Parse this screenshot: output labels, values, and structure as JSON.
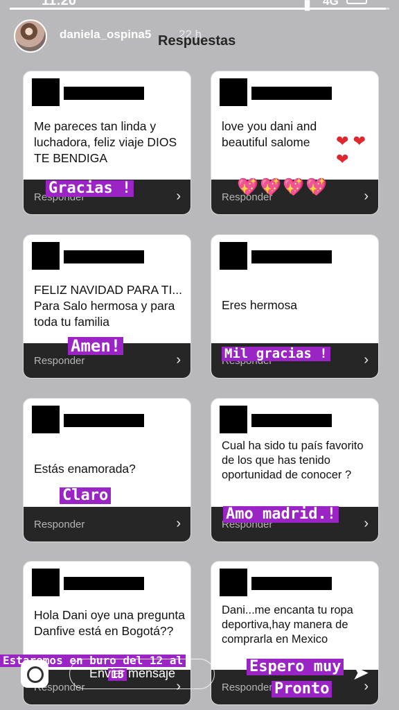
{
  "status": {
    "time": "11:20",
    "network": "4G"
  },
  "story": {
    "progress": 0.99
  },
  "header": {
    "username": "daniela_ospina5",
    "time_ago": "22 h",
    "sheet_title": "Respuestas"
  },
  "cards": [
    {
      "message": "Me pareces tan linda y luchadora, feliz viaje DIOS TE BENDIGA",
      "reply_label": "Responder",
      "sticker": "Gracias !"
    },
    {
      "message": "love you dani and beautiful salome",
      "message_emoji": "❤ ❤ ❤",
      "reply_label": "Responder",
      "sticker_emoji": "💖💖💖💖"
    },
    {
      "message": "FELIZ NAVIDAD PARA TI... Para Salo hermosa y para toda tu familia",
      "reply_label": "Responder",
      "sticker": "Amen!"
    },
    {
      "message": "Eres hermosa",
      "reply_label": "Responder",
      "sticker": "Mil gracias !"
    },
    {
      "message": "Estás enamorada?",
      "reply_label": "Responder",
      "sticker": "Claro"
    },
    {
      "message": "Cual ha sido tu país favorito de los que has tenido oportunidad de conocer ?",
      "reply_label": "Responder",
      "sticker": "Amo madrid.!"
    },
    {
      "message": "Hola Dani oye una pregunta Danfive está en Bogotá??",
      "reply_label": "Responder"
    },
    {
      "message": "Dani...me encanta tu ropa deportiva,hay manera de comprarla en Mexico",
      "reply_label": "Responder"
    }
  ],
  "stickers_bottom": {
    "left_line1": "Estaremos en buro del 12 al",
    "left_line2": "15",
    "right_line1": "Espero muy",
    "right_line2": "Pronto"
  },
  "composer": {
    "placeholder": "Enviar mensaje"
  },
  "icons": {
    "camera": "camera-icon",
    "send": "send-icon",
    "chevron": "chevron-right-icon"
  }
}
